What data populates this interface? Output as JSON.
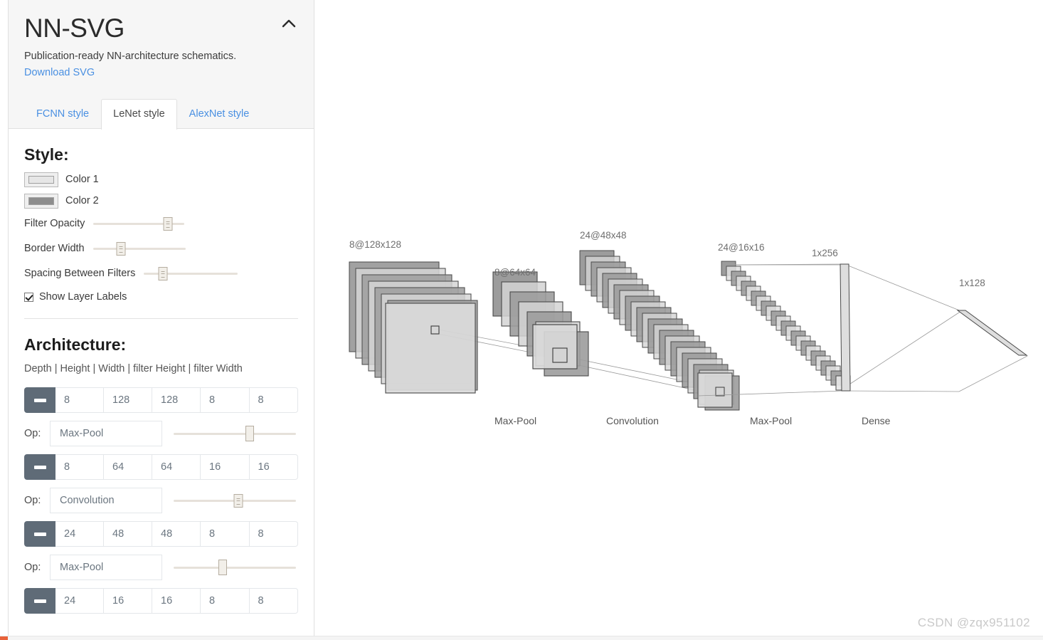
{
  "app": {
    "title": "NN-SVG",
    "subtitle": "Publication-ready NN-architecture schematics.",
    "download_link": "Download SVG",
    "collapse_icon": "chevron-up-icon"
  },
  "tabs": [
    {
      "label": "FCNN style",
      "active": false
    },
    {
      "label": "LeNet style",
      "active": true
    },
    {
      "label": "AlexNet style",
      "active": false
    }
  ],
  "style_section": {
    "heading": "Style:",
    "colors": [
      {
        "label": "Color 1",
        "value": "#e6e6e6"
      },
      {
        "label": "Color 2",
        "value": "#8d8d8d"
      }
    ],
    "sliders": [
      {
        "label": "Filter Opacity",
        "percent": 82,
        "track_width": 128
      },
      {
        "label": "Border Width",
        "percent": 30,
        "track_width": 130
      },
      {
        "label": "Spacing Between Filters",
        "percent": 20,
        "track_width": 132
      }
    ],
    "checkbox": {
      "label": "Show Layer Labels",
      "checked": true
    }
  },
  "architecture_section": {
    "heading": "Architecture:",
    "columns_hint": "Depth | Height | Width | filter Height | filter Width",
    "minus_icon": "minus-icon",
    "op_prefix": "Op:",
    "layers": [
      {
        "depth": "8",
        "height": "128",
        "width": "128",
        "filter_height": "8",
        "filter_width": "8"
      },
      {
        "depth": "8",
        "height": "64",
        "width": "64",
        "filter_height": "16",
        "filter_width": "16"
      },
      {
        "depth": "24",
        "height": "48",
        "width": "48",
        "filter_height": "8",
        "filter_width": "8"
      },
      {
        "depth": "24",
        "height": "16",
        "width": "16",
        "filter_height": "8",
        "filter_width": "8"
      }
    ],
    "ops": [
      {
        "name": "Max-Pool",
        "percent": 62
      },
      {
        "name": "Convolution",
        "percent": 53
      },
      {
        "name": "Max-Pool",
        "percent": 40
      }
    ]
  },
  "diagram": {
    "layer_captions": [
      "8@128x128",
      "8@64x64",
      "24@48x48",
      "24@16x16",
      "1x256",
      "1x128"
    ],
    "op_captions": [
      "Max-Pool",
      "Convolution",
      "Max-Pool",
      "Dense"
    ],
    "colors": {
      "front_fill": "#d9d9d9",
      "back_fill": "#9c9c9c",
      "stroke": "#4a4a4a",
      "connector": "#8a8a8a"
    }
  },
  "watermark": "CSDN @zqx951102"
}
